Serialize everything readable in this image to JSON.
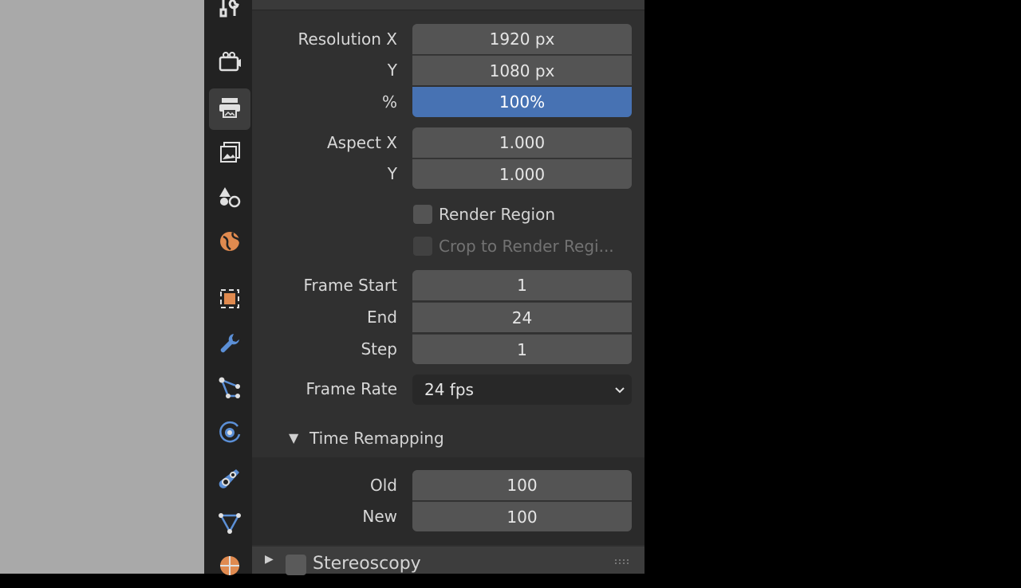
{
  "format": {
    "resolution_x_label": "Resolution X",
    "resolution_x_value": "1920 px",
    "resolution_y_label": "Y",
    "resolution_y_value": "1080 px",
    "percent_label": "%",
    "percent_value": "100%",
    "aspect_x_label": "Aspect X",
    "aspect_x_value": "1.000",
    "aspect_y_label": "Y",
    "aspect_y_value": "1.000",
    "render_region_label": "Render Region",
    "render_region_checked": false,
    "crop_label": "Crop to Render Regi...",
    "crop_checked": false
  },
  "frame_range": {
    "start_label": "Frame Start",
    "start_value": "1",
    "end_label": "End",
    "end_value": "24",
    "step_label": "Step",
    "step_value": "1"
  },
  "frame_rate": {
    "label": "Frame Rate",
    "value": "24 fps"
  },
  "time_remapping": {
    "title": "Time Remapping",
    "expanded": true,
    "old_label": "Old",
    "old_value": "100",
    "new_label": "New",
    "new_value": "100"
  },
  "stereoscopy": {
    "title": "Stereoscopy",
    "expanded": false,
    "enabled": false
  },
  "tabs": [
    {
      "icon": "tool-icon"
    },
    {
      "icon": "render-icon"
    },
    {
      "icon": "output-icon",
      "active": true
    },
    {
      "icon": "view-layer-icon"
    },
    {
      "icon": "scene-icon"
    },
    {
      "icon": "world-icon"
    },
    {
      "icon": "object-icon"
    },
    {
      "icon": "modifier-wrench-icon"
    },
    {
      "icon": "particles-icon"
    },
    {
      "icon": "physics-icon"
    },
    {
      "icon": "constraints-icon"
    },
    {
      "icon": "object-data-mesh-icon"
    },
    {
      "icon": "material-icon"
    }
  ],
  "colors": {
    "accent_selected": "#4772b3",
    "panel_bg": "#303030",
    "field_bg": "#545454",
    "orange_icon": "#e08a4f",
    "blue_icon": "#5b8fd6"
  }
}
